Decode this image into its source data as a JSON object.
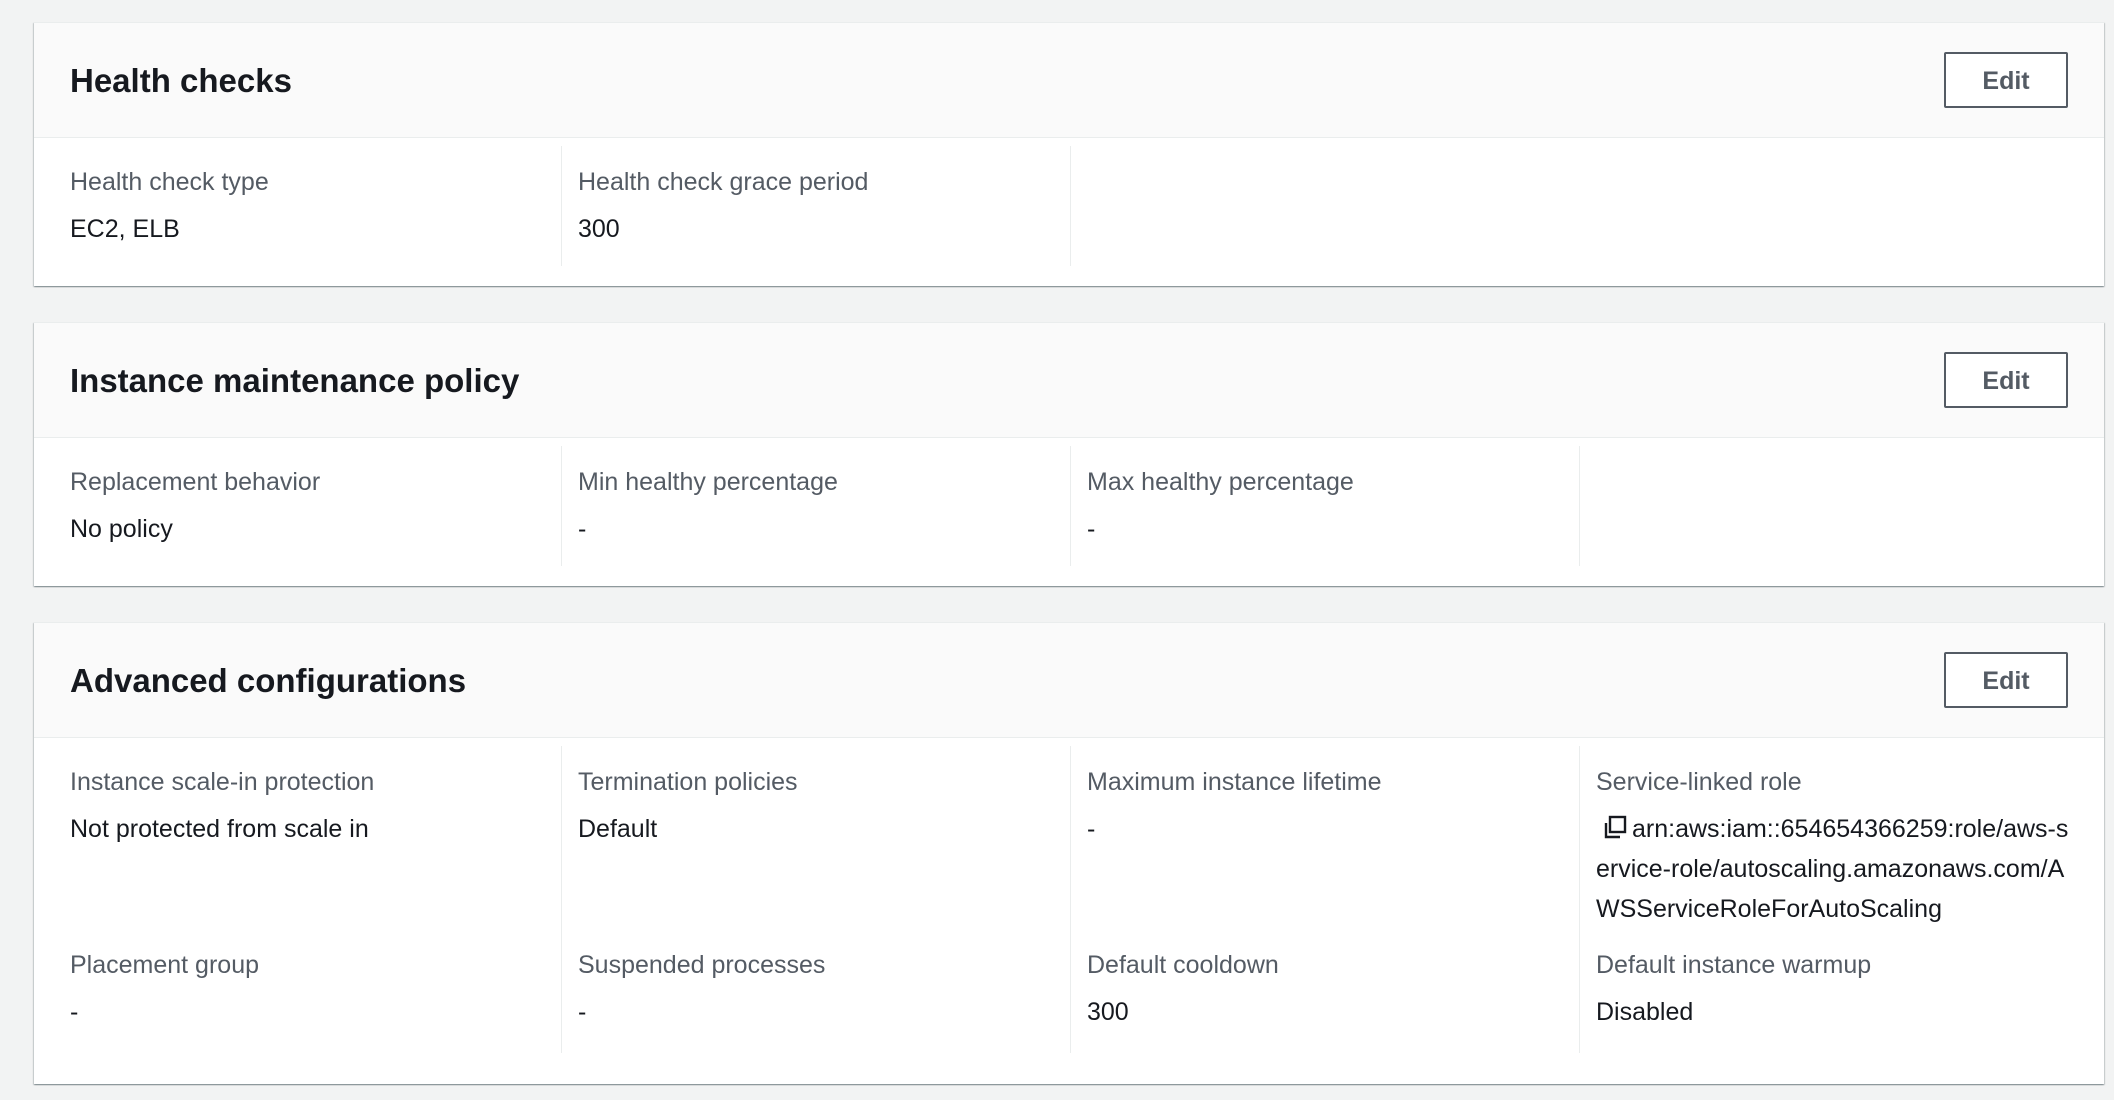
{
  "health_checks": {
    "title": "Health checks",
    "edit_label": "Edit",
    "fields": [
      {
        "label": "Health check type",
        "value": "EC2, ELB"
      },
      {
        "label": "Health check grace period",
        "value": "300"
      }
    ]
  },
  "maintenance": {
    "title": "Instance maintenance policy",
    "edit_label": "Edit",
    "fields": [
      {
        "label": "Replacement behavior",
        "value": "No policy"
      },
      {
        "label": "Min healthy percentage",
        "value": "-"
      },
      {
        "label": "Max healthy percentage",
        "value": "-"
      }
    ]
  },
  "advanced": {
    "title": "Advanced configurations",
    "edit_label": "Edit",
    "row1": [
      {
        "label": "Instance scale-in protection",
        "value": "Not protected from scale in"
      },
      {
        "label": "Termination policies",
        "value": "Default"
      },
      {
        "label": "Maximum instance lifetime",
        "value": "-"
      },
      {
        "label": "Service-linked role",
        "value": "arn:aws:iam::654654366259:role/aws-service-role/autoscaling.amazonaws.com/AWSServiceRoleForAutoScaling",
        "icon": "copy-icon"
      }
    ],
    "row2": [
      {
        "label": "Placement group",
        "value": "-"
      },
      {
        "label": "Suspended processes",
        "value": "-"
      },
      {
        "label": "Default cooldown",
        "value": "300"
      },
      {
        "label": "Default instance warmup",
        "value": "Disabled"
      }
    ]
  },
  "colors": {
    "page_bg": "#f2f3f3",
    "panel_bg": "#ffffff",
    "header_bg": "#fafafa",
    "label": "#545b64",
    "text": "#16191f",
    "divider": "#eaeded"
  }
}
